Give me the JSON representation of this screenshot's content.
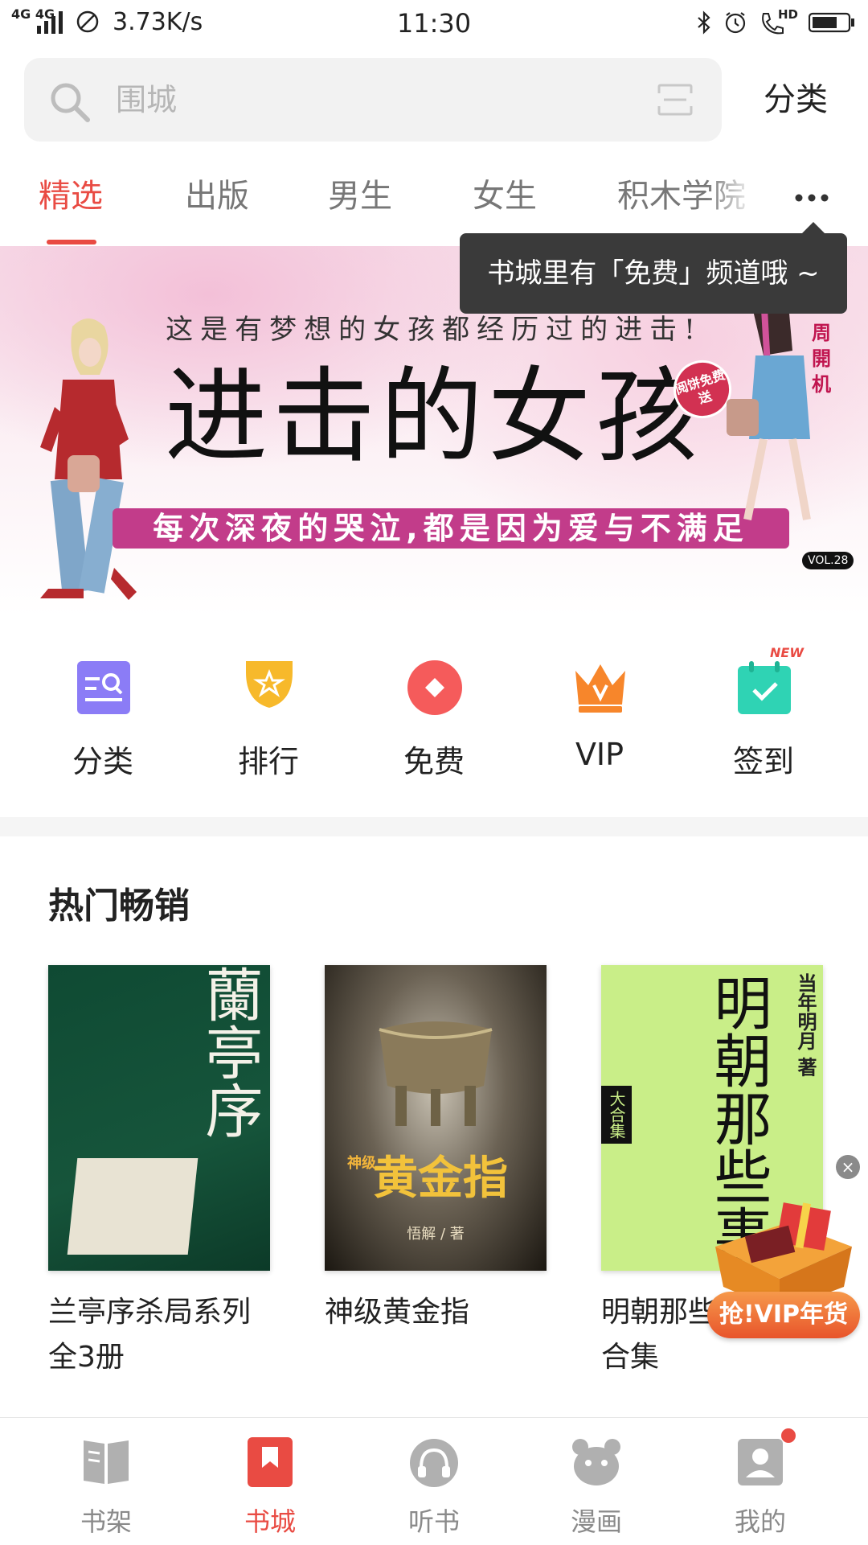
{
  "status_bar": {
    "network": "4G 4G",
    "speed": "3.73K/s",
    "time": "11:30",
    "hd": "HD"
  },
  "search": {
    "placeholder": "围城",
    "category_label": "分类"
  },
  "tabs": [
    {
      "label": "精选",
      "active": true
    },
    {
      "label": "出版",
      "active": false
    },
    {
      "label": "男生",
      "active": false
    },
    {
      "label": "女生",
      "active": false
    },
    {
      "label": "积木学院",
      "active": false
    }
  ],
  "tooltip": {
    "text": "书城里有「免费」频道哦 ~"
  },
  "banner": {
    "subtitle": "这是有梦想的女孩都经历过的进击!",
    "title": "进击的女孩",
    "tagline": "每次深夜的哭泣,都是因为爱与不满足",
    "seal": "阅饼免费送",
    "side_text": "周開机",
    "vol": "VOL.28"
  },
  "quick_links": [
    {
      "label": "分类",
      "icon": "category-search-icon",
      "color": "#8b7cf6"
    },
    {
      "label": "排行",
      "icon": "trophy-icon",
      "color": "#f7b92b"
    },
    {
      "label": "免费",
      "icon": "diamond-icon",
      "color": "#f55b5b"
    },
    {
      "label": "VIP",
      "icon": "crown-icon",
      "color": "#f7862b"
    },
    {
      "label": "签到",
      "icon": "calendar-check-icon",
      "color": "#2fd3b4",
      "badge": "NEW"
    }
  ],
  "hot_section": {
    "title": "热门畅销",
    "books": [
      {
        "title": "兰亭序杀局系列全3册",
        "line1": "兰亭序杀局系列",
        "line2": "全3册",
        "cover_text": "蘭亭序"
      },
      {
        "title": "神级黄金指",
        "line1": "神级黄金指",
        "line2": "",
        "cover_text": "黄金指",
        "cover_small": "神级",
        "author": "悟解 / 著"
      },
      {
        "title": "明朝那些事儿合集",
        "line1": "明朝那些",
        "line2": "合集",
        "cover_text": "明朝那些事",
        "author": "当年明月 著",
        "badge": "大合集"
      }
    ]
  },
  "promo": {
    "label": "抢!VIP年货",
    "close": "×"
  },
  "bottom_nav": [
    {
      "label": "书架",
      "icon": "bookshelf-icon",
      "active": false
    },
    {
      "label": "书城",
      "icon": "bookmark-icon",
      "active": true
    },
    {
      "label": "听书",
      "icon": "headphones-icon",
      "active": false
    },
    {
      "label": "漫画",
      "icon": "bear-icon",
      "active": false
    },
    {
      "label": "我的",
      "icon": "profile-icon",
      "active": false
    }
  ],
  "colors": {
    "accent": "#e94b43",
    "tooltip_bg": "#3a3a3a",
    "banner_tag": "#c23c8a"
  }
}
